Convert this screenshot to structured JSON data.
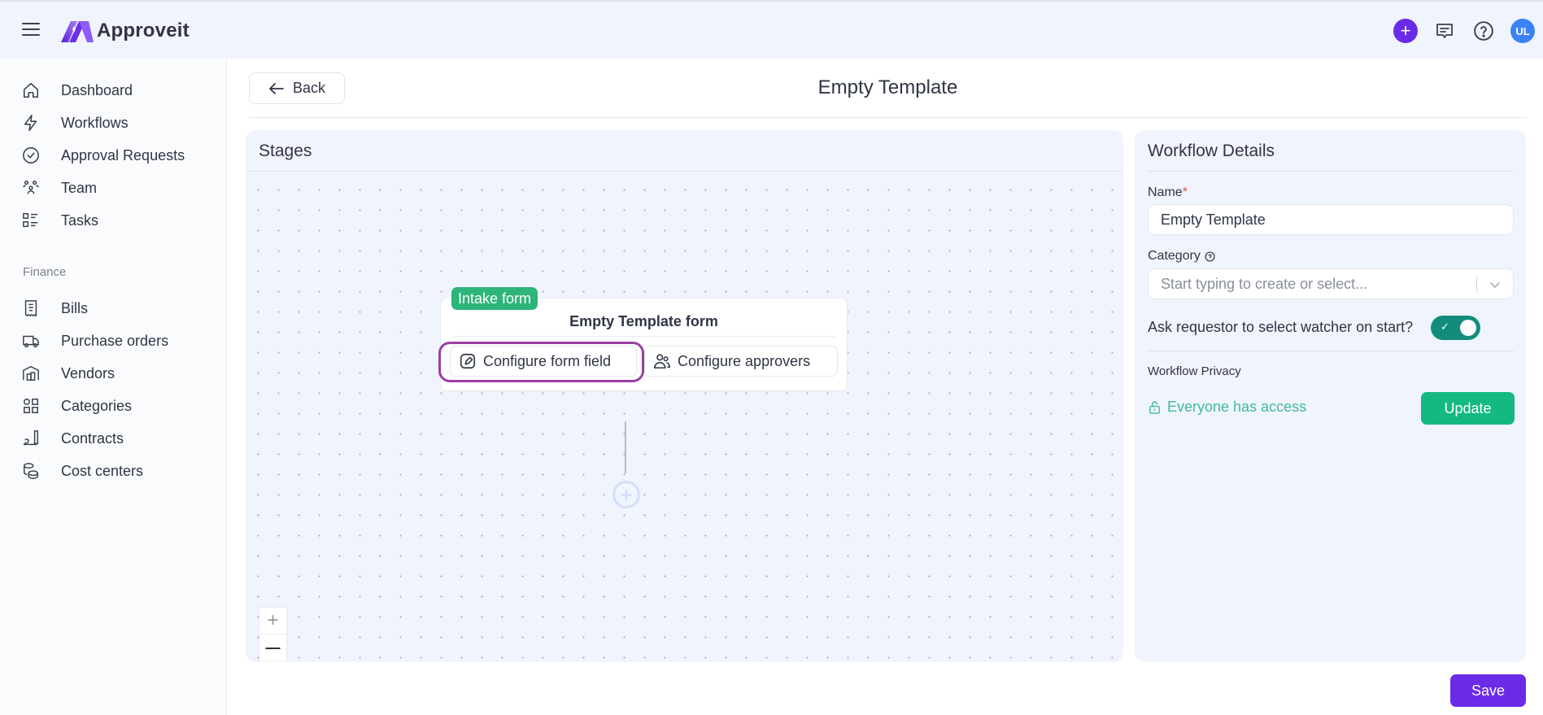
{
  "app": {
    "name": "Approveit",
    "brand_color": "#6a2be8"
  },
  "topbar": {
    "icons": [
      "menu-icon",
      "plus-icon",
      "chat-icon",
      "help-icon"
    ],
    "avatar_initials": "UL"
  },
  "sidebar": {
    "items": [
      {
        "label": "Dashboard",
        "icon": "home-icon"
      },
      {
        "label": "Workflows",
        "icon": "lightning-icon"
      },
      {
        "label": "Approval Requests",
        "icon": "check-circle-icon"
      },
      {
        "label": "Team",
        "icon": "team-icon"
      },
      {
        "label": "Tasks",
        "icon": "tasks-icon"
      }
    ],
    "finance_label": "Finance",
    "finance_items": [
      {
        "label": "Bills",
        "icon": "receipt-icon"
      },
      {
        "label": "Purchase orders",
        "icon": "truck-icon"
      },
      {
        "label": "Vendors",
        "icon": "warehouse-icon"
      },
      {
        "label": "Categories",
        "icon": "grid-icon"
      },
      {
        "label": "Contracts",
        "icon": "signature-icon"
      },
      {
        "label": "Cost centers",
        "icon": "coins-icon"
      }
    ]
  },
  "header": {
    "back_label": "Back",
    "title": "Empty Template"
  },
  "stages": {
    "title": "Stages",
    "card": {
      "badge": "Intake form",
      "title": "Empty Template form",
      "configure_form_label": "Configure form field",
      "configure_approvers_label": "Configure approvers"
    },
    "zoom_controls": {
      "zoom_in": "+",
      "zoom_out": "—"
    }
  },
  "details": {
    "title": "Workflow Details",
    "name_label": "Name",
    "required_mark": "*",
    "name_value": "Empty Template",
    "category_label": "Category",
    "category_placeholder": "Start typing to create or select...",
    "watcher_question": "Ask requestor to select watcher on start?",
    "watcher_enabled": true,
    "privacy_label": "Workflow Privacy",
    "privacy_value": "Everyone has access",
    "update_label": "Update"
  },
  "footer": {
    "save_label": "Save"
  }
}
